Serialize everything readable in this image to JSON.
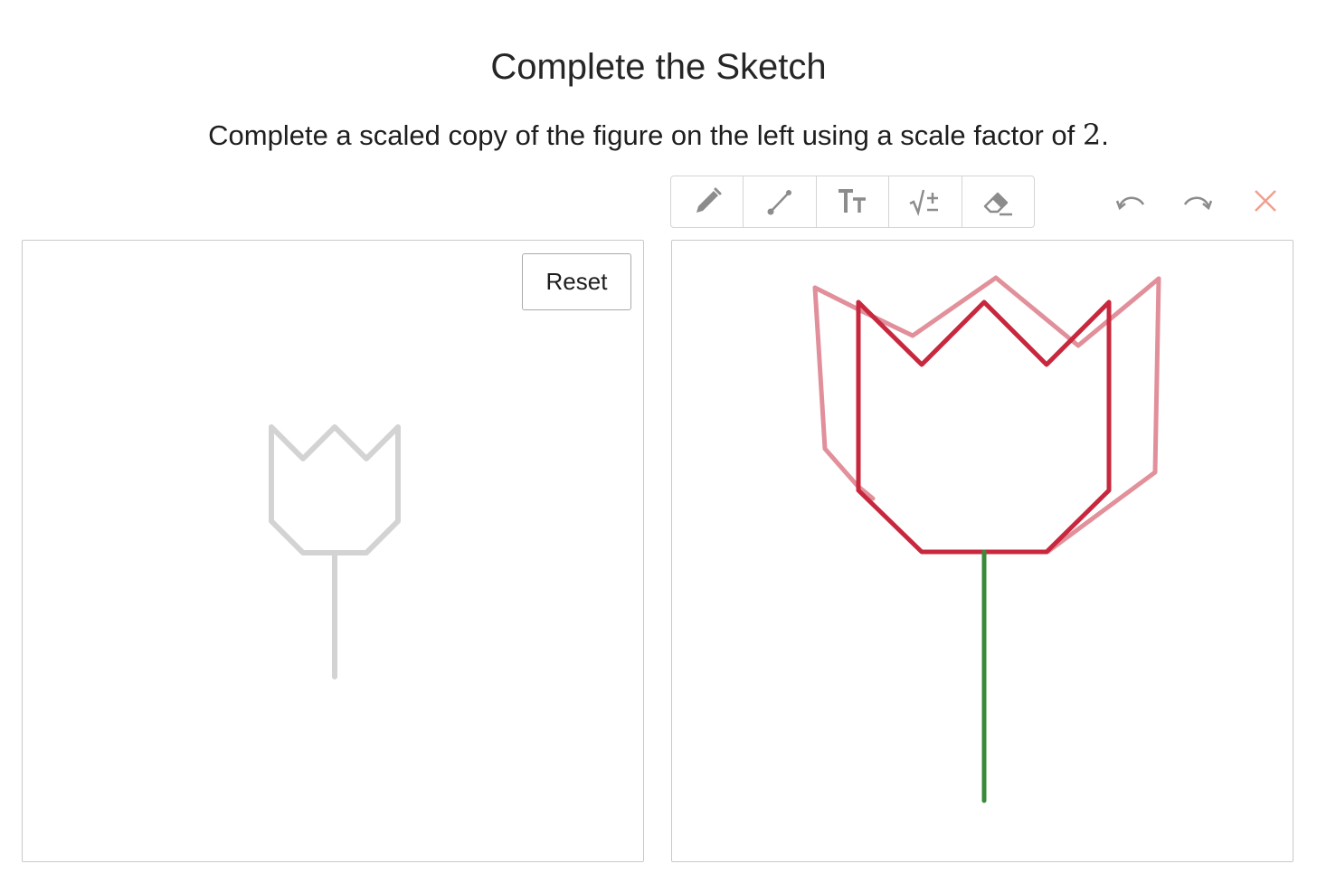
{
  "header": {
    "title": "Complete the Sketch",
    "instruction_text": "Complete a scaled copy of the figure on the left using a scale factor of",
    "scale_factor": "2",
    "instruction_end": "."
  },
  "toolbar": {
    "tools": [
      {
        "name": "pencil-tool",
        "icon": "pencil-icon"
      },
      {
        "name": "line-tool",
        "icon": "line-segment-icon"
      },
      {
        "name": "text-tool",
        "icon": "text-size-icon",
        "label": "TT"
      },
      {
        "name": "math-tool",
        "icon": "square-root-plus-minus-icon",
        "label": "√±"
      },
      {
        "name": "eraser-tool",
        "icon": "eraser-icon"
      }
    ],
    "actions": {
      "undo_icon": "undo-icon",
      "redo_icon": "redo-icon",
      "clear_icon": "close-icon"
    }
  },
  "original_panel": {
    "reset_label": "Reset"
  },
  "colors": {
    "original_figure": "#d3d3d3",
    "scaled_outline": "#c8283e",
    "faded_strokes": "#e08a95",
    "stem_green": "#3a8a3a",
    "clear_x": "#f0a08e",
    "icon_gray": "#8c8c8c"
  }
}
